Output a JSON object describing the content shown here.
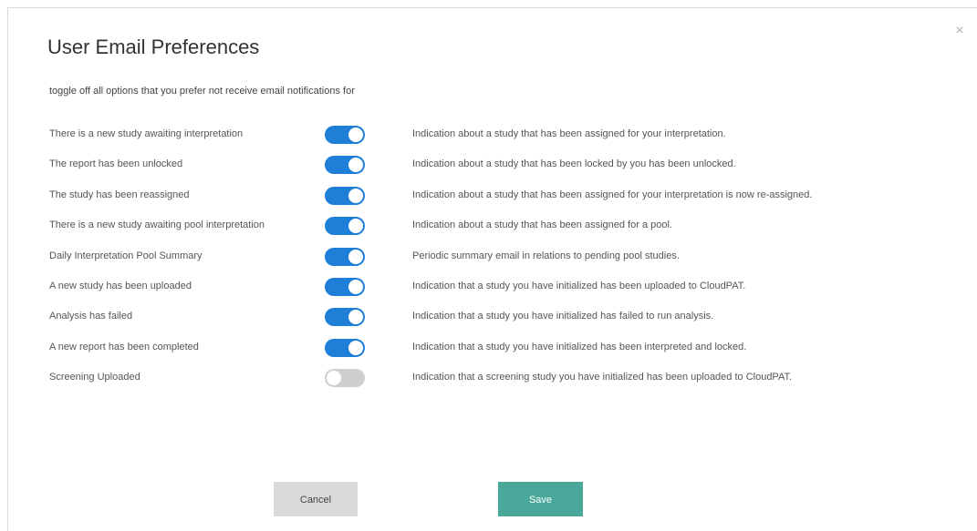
{
  "dialog": {
    "title": "User Email Preferences",
    "subtitle": "toggle off all options that you prefer not receive email notifications for",
    "close_glyph": "×"
  },
  "preferences": [
    {
      "label": "There is a new study awaiting interpretation",
      "enabled": true,
      "description": "Indication about a study that has been assigned for your interpretation."
    },
    {
      "label": "The report has been unlocked",
      "enabled": true,
      "description": "Indication about a study that has been locked by you has been unlocked."
    },
    {
      "label": "The study has been reassigned",
      "enabled": true,
      "description": "Indication about a study that has been assigned for your interpretation is now re-assigned."
    },
    {
      "label": "There is a new study awaiting pool interpretation",
      "enabled": true,
      "description": "Indication about a study that has been assigned for a pool."
    },
    {
      "label": "Daily Interpretation Pool Summary",
      "enabled": true,
      "description": "Periodic summary email in relations to pending pool studies."
    },
    {
      "label": "A new study has been uploaded",
      "enabled": true,
      "description": "Indication that a study you have initialized has been uploaded to CloudPAT."
    },
    {
      "label": "Analysis has failed",
      "enabled": true,
      "description": "Indication that a study you have initialized has failed to run analysis."
    },
    {
      "label": "A new report has been completed",
      "enabled": true,
      "description": "Indication that a study you have initialized has been interpreted and locked."
    },
    {
      "label": "Screening Uploaded",
      "enabled": false,
      "description": "Indication that a screening study you have initialized has been uploaded to CloudPAT."
    }
  ],
  "buttons": {
    "cancel_label": "Cancel",
    "save_label": "Save"
  },
  "colors": {
    "toggle_on": "#1f7fd8",
    "toggle_off": "#cfcfcf",
    "save_button": "#4aa89a",
    "cancel_button": "#d9d9d9"
  }
}
